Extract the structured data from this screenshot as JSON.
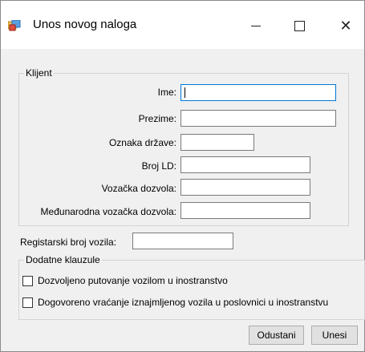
{
  "window": {
    "title": "Unos novog naloga",
    "icon": "form-icon"
  },
  "klijent": {
    "legend": "Klijent",
    "fields": [
      {
        "label": "Ime:",
        "value": ""
      },
      {
        "label": "Prezime:",
        "value": ""
      },
      {
        "label": "Oznaka države:",
        "value": ""
      },
      {
        "label": "Broj LD:",
        "value": ""
      },
      {
        "label": "Vozačka dozvola:",
        "value": ""
      },
      {
        "label": "Međunarodna vozačka dozvola:",
        "value": ""
      }
    ]
  },
  "registarski": {
    "label": "Registarski broj vozila:",
    "value": ""
  },
  "klauzule": {
    "legend": "Dodatne klauzule",
    "options": [
      {
        "label": "Dozvoljeno putovanje vozilom u inostranstvo",
        "checked": false
      },
      {
        "label": "Dogovoreno vraćanje iznajmljenog vozila u poslovnici u inostranstvu",
        "checked": false
      }
    ]
  },
  "buttons": {
    "cancel": "Odustani",
    "submit": "Unesi"
  }
}
